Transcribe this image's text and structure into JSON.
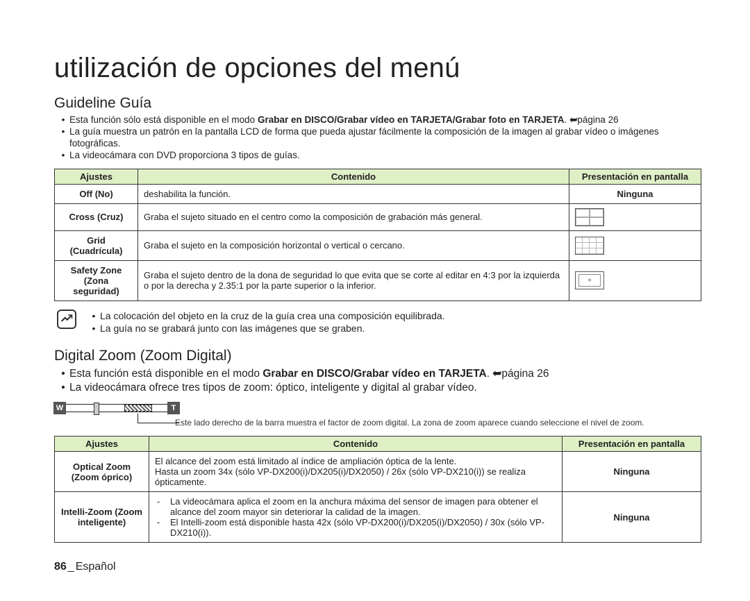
{
  "title": "utilización de opciones del menú",
  "guideline": {
    "heading": "Guideline Guía",
    "bullets": [
      {
        "prefix": "Esta función sólo está disponible en el modo ",
        "bold": "Grabar en DISCO/Grabar vídeo en TARJETA/Grabar foto en TARJETA",
        "suffix": ". ",
        "page": "página 26"
      },
      {
        "text": "La guía muestra un patrón en la pantalla LCD de forma que pueda ajustar fácilmente la composición de la imagen al grabar vídeo o imágenes fotográficas."
      },
      {
        "text": "La videocámara con DVD proporciona 3 tipos de guías."
      }
    ],
    "table": {
      "headers": {
        "settings": "Ajustes",
        "content": "Contenido",
        "display": "Presentación en pantalla"
      },
      "rows": [
        {
          "setting": "Off (No)",
          "content": "deshabilita la función.",
          "display_label": "Ninguna",
          "icon": "none"
        },
        {
          "setting": "Cross (Cruz)",
          "content": "Graba el sujeto situado en el centro como la composición de grabación más general.",
          "icon": "cross"
        },
        {
          "setting": "Grid (Cuadrícula)",
          "content": "Graba el sujeto en la composición horizontal o vertical o cercano.",
          "icon": "grid"
        },
        {
          "setting": "Safety Zone (Zona seguridad)",
          "content": "Graba el sujeto dentro de la dona de seguridad lo que evita que se corte al editar en 4:3 por la izquierda o por la derecha y 2.35:1 por la parte superior o la inferior.",
          "icon": "safety"
        }
      ]
    },
    "note": [
      "La colocación del objeto en la cruz de la guía crea una composición equilibrada.",
      "La guía no se grabará junto con las imágenes que se graben."
    ]
  },
  "digitalzoom": {
    "heading": "Digital Zoom (Zoom Digital)",
    "bullets": [
      {
        "prefix": "Esta función está disponible en el modo ",
        "bold": "Grabar en DISCO/Grabar vídeo en TARJETA",
        "suffix": ". ",
        "page": "página 26"
      },
      {
        "text": "La videocámara ofrece tres tipos de zoom: óptico, inteligente y digital al grabar vídeo."
      }
    ],
    "zoom_caption": "Este lado derecho de la barra muestra el factor de zoom digital. La zona de zoom aparece cuando seleccione el nivel de zoom.",
    "zoom_w": "W",
    "zoom_t": "T",
    "table": {
      "headers": {
        "settings": "Ajustes",
        "content": "Contenido",
        "display": "Presentación en pantalla"
      },
      "rows": [
        {
          "setting": "Optical Zoom (Zoom óprico)",
          "content_line1": "El alcance del zoom está limitado al índice de ampliación óptica de la lente.",
          "content_line2": "Hasta un zoom 34x (sólo VP-DX200(i)/DX205(i)/DX2050) / 26x (sólo VP-DX210(i)) se realiza ópticamente.",
          "display": "Ninguna"
        },
        {
          "setting": "Intelli-Zoom (Zoom inteligente)",
          "dash1": "La videocámara aplica el zoom en la anchura máxima del sensor de imagen para obtener el alcance del zoom mayor sin deteriorar la calidad de la imagen.",
          "dash2": "El Intelli-zoom está disponible hasta 42x (sólo VP-DX200(i)/DX205(i)/DX2050) / 30x (sólo VP-DX210(i)).",
          "display": "Ninguna"
        }
      ]
    }
  },
  "footer": {
    "page_num": "86",
    "lang": "Español"
  }
}
